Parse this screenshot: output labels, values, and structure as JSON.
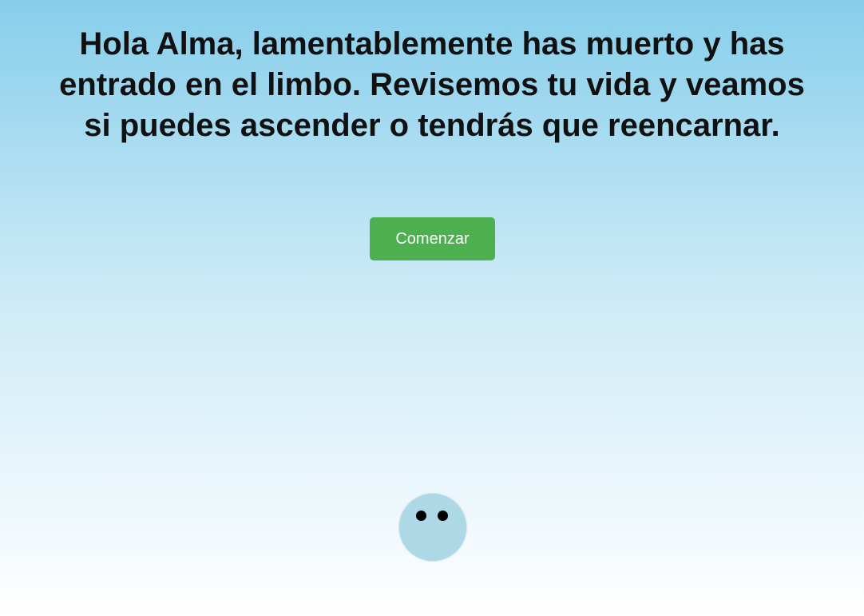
{
  "intro": {
    "message": "Hola Alma, lamentablemente has muerto y has entrado en el limbo. Revisemos tu vida y veamos si puedes ascender o tendrás que reencarnar.",
    "start_label": "Comenzar"
  },
  "colors": {
    "background_top": "#87ceeb",
    "background_bottom": "#ffffff",
    "button": "#4caf50",
    "button_text": "#ffffff",
    "soul_body": "#add8e6",
    "soul_eyes": "#000000",
    "text": "#111111"
  },
  "character": {
    "icon": "soul-character-icon"
  }
}
